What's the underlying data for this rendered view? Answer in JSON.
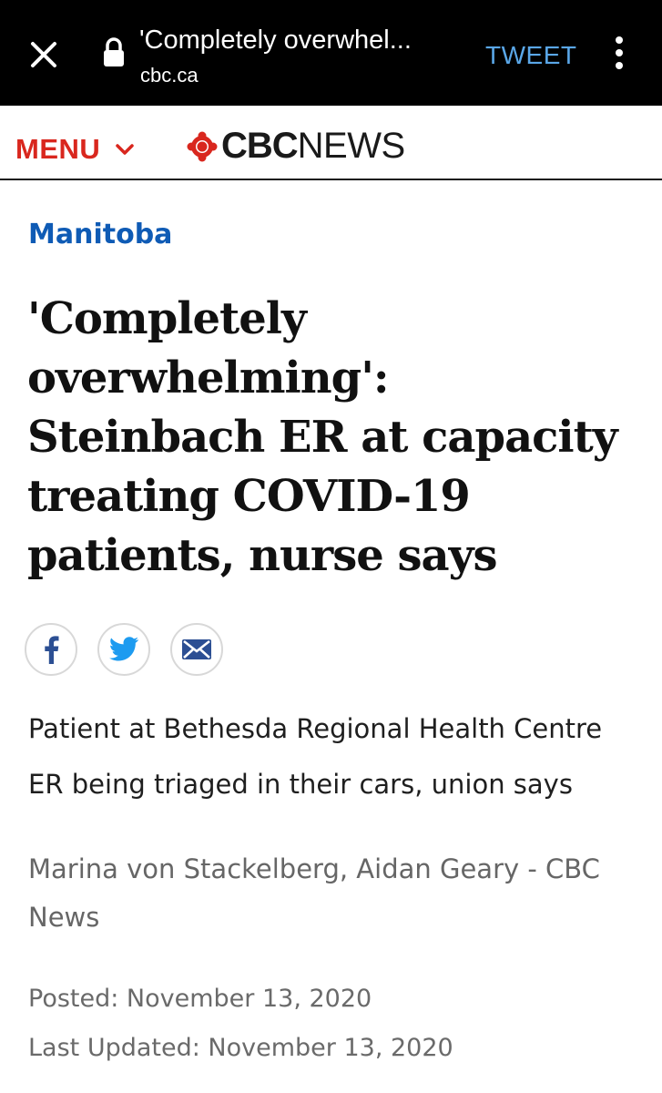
{
  "browser": {
    "title": "'Completely overwhel...",
    "domain": "cbc.ca",
    "tweet_label": "TWEET"
  },
  "header": {
    "menu_label": "MENU",
    "logo_cbc": "CBC",
    "logo_news": "NEWS",
    "accent_color": "#d9271e"
  },
  "article": {
    "section": "Manitoba",
    "headline_lines": [
      "'Completely",
      "overwhelming':",
      "Steinbach ER at capacity",
      "treating COVID-19",
      "patients, nurse says"
    ],
    "share_icons": [
      "facebook-icon",
      "twitter-icon",
      "email-icon"
    ],
    "deck_lines": [
      "Patient at Bethesda Regional Health Centre",
      "ER being triaged in their cars, union says"
    ],
    "byline_lines": [
      "Marina von Stackelberg, Aidan Geary - CBC",
      "News"
    ],
    "posted": "Posted: November 13, 2020",
    "updated": "Last Updated: November 13, 2020",
    "section_color": "#0f5bb5"
  }
}
